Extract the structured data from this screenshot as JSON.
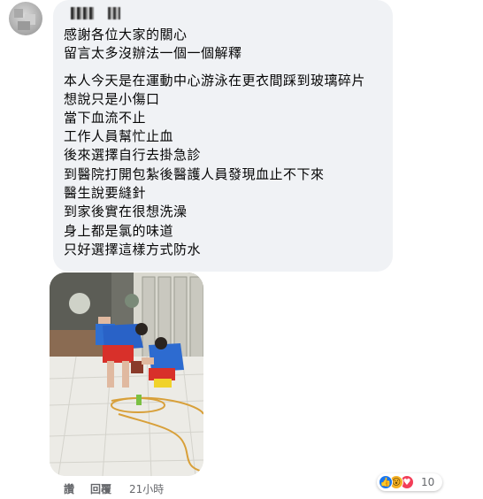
{
  "comment": {
    "greeting_lines": [
      "感謝各位大家的關心",
      "留言太多沒辦法一個一個解釋"
    ],
    "story_lines": [
      "本人今天是在運動中心游泳在更衣間踩到玻璃碎片",
      "想說只是小傷口",
      "當下血流不止",
      "工作人員幫忙止血",
      "後來選擇自行去掛急診",
      "到醫院打開包紮後醫護人員發現血止不下來",
      "醫生說要縫針",
      "到家後實在很想洗澡",
      "身上都是氯的味道",
      "只好選擇這樣方式防水"
    ]
  },
  "actions": {
    "like_label": "讚",
    "reply_label": "回覆",
    "timestamp": "21小時"
  },
  "reactions": {
    "icons": [
      "like-icon",
      "wow-icon",
      "love-icon"
    ],
    "count": "10"
  },
  "colors": {
    "bubble_bg": "#f0f2f5",
    "text": "#050505",
    "meta_text": "#65676b",
    "like_blue": "#1877f2",
    "love_red": "#f33e58",
    "wow_yellow": "#f7b125"
  }
}
